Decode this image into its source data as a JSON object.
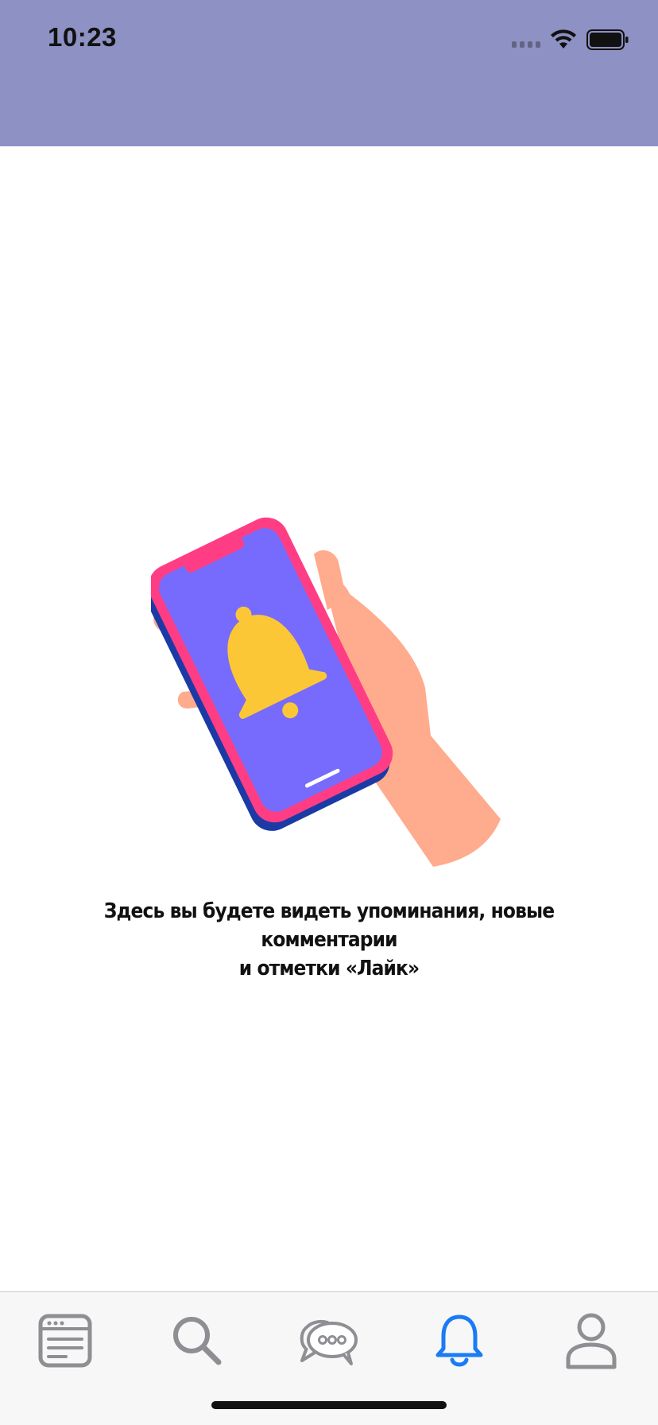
{
  "status_bar": {
    "time": "10:23",
    "icons": [
      "cellular-signal-icon",
      "wifi-icon",
      "battery-icon"
    ]
  },
  "header": {
    "background_color": "#8e91c3"
  },
  "empty_state": {
    "illustration": "hand-holding-phone-with-bell-illustration",
    "message_line1": "Здесь вы будете видеть упоминания, новые комментарии",
    "message_line2": "и отметки «Лайк»"
  },
  "tab_bar": {
    "active_color": "#1a7cf5",
    "inactive_color": "#8e8e93",
    "tabs": [
      {
        "icon": "feed-icon",
        "active": false
      },
      {
        "icon": "search-icon",
        "active": false
      },
      {
        "icon": "chat-bubbles-icon",
        "active": false
      },
      {
        "icon": "bell-icon",
        "active": true
      },
      {
        "icon": "profile-icon",
        "active": false
      }
    ]
  }
}
